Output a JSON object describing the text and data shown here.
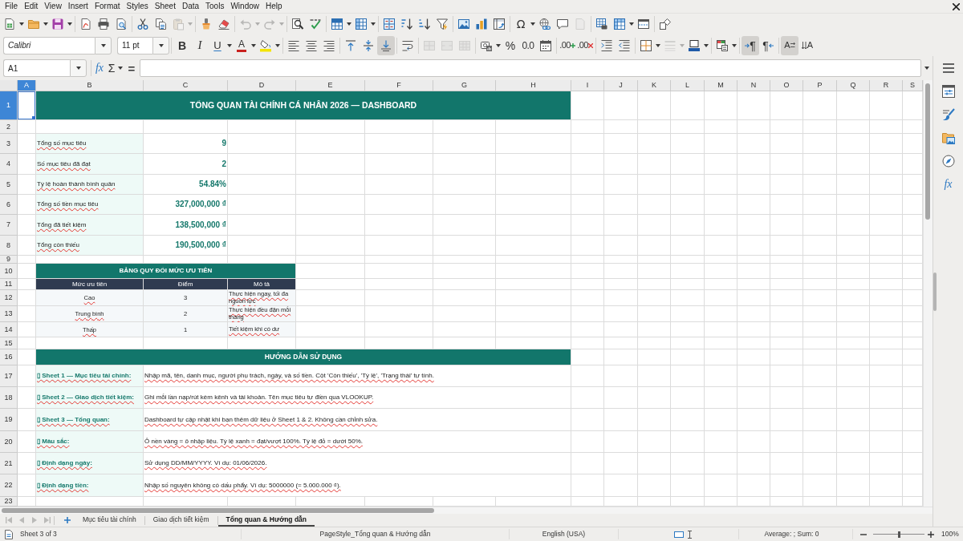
{
  "menu": [
    "File",
    "Edit",
    "View",
    "Insert",
    "Format",
    "Styles",
    "Sheet",
    "Data",
    "Tools",
    "Window",
    "Help"
  ],
  "toolbar_standard": [
    [
      {
        "kind": "new",
        "dropdown": true,
        "disabled": false
      },
      {
        "kind": "open",
        "dropdown": true,
        "disabled": false
      },
      {
        "kind": "save",
        "dropdown": true,
        "disabled": false
      }
    ],
    [
      {
        "kind": "pdf",
        "disabled": false
      },
      {
        "kind": "print",
        "disabled": false
      },
      {
        "kind": "preview",
        "disabled": false
      }
    ],
    [
      {
        "kind": "cut",
        "disabled": false
      },
      {
        "kind": "copy",
        "disabled": false
      },
      {
        "kind": "paste",
        "dropdown": true,
        "disabled": true
      }
    ],
    [
      {
        "kind": "clone",
        "disabled": false
      },
      {
        "kind": "clear",
        "disabled": false
      }
    ],
    [
      {
        "kind": "undo",
        "dropdown": true,
        "disabled": true
      },
      {
        "kind": "redo",
        "dropdown": true,
        "disabled": true
      }
    ],
    [
      {
        "kind": "find",
        "disabled": false
      },
      {
        "kind": "spelling",
        "disabled": false
      }
    ],
    [
      {
        "kind": "rows",
        "dropdown": true,
        "disabled": false
      },
      {
        "kind": "columns",
        "dropdown": true,
        "disabled": false
      }
    ],
    [
      {
        "kind": "sort",
        "disabled": false
      },
      {
        "kind": "sortup",
        "disabled": false
      },
      {
        "kind": "sortdown",
        "disabled": false
      },
      {
        "kind": "autofilter",
        "disabled": false
      }
    ],
    [
      {
        "kind": "image",
        "disabled": false
      },
      {
        "kind": "chart",
        "disabled": false
      },
      {
        "kind": "pivot",
        "disabled": false
      }
    ],
    [
      {
        "kind": "specialchar",
        "glyph": "Ω",
        "dropdown": true,
        "disabled": false
      },
      {
        "kind": "hyperlink",
        "disabled": false
      },
      {
        "kind": "comment",
        "disabled": false
      },
      {
        "kind": "headerfooter",
        "disabled": true
      }
    ],
    [
      {
        "kind": "printarea",
        "disabled": false
      },
      {
        "kind": "freeze",
        "dropdown": true,
        "disabled": false
      },
      {
        "kind": "split",
        "disabled": false
      }
    ],
    [
      {
        "kind": "shapes",
        "disabled": false
      }
    ]
  ],
  "toolbar_formatting": {
    "font_name": "Calibri",
    "font_size": "11 pt",
    "groups": [
      [
        {
          "kind": "bold",
          "glyph": "B",
          "disabled": false,
          "on": false
        },
        {
          "kind": "italic",
          "glyph": "I",
          "disabled": false,
          "on": false
        },
        {
          "kind": "underline",
          "glyph": "U",
          "dropdown": true,
          "disabled": false,
          "on": false
        },
        {
          "kind": "fontcolor",
          "glyph": "A",
          "dropdown": true,
          "disabled": false,
          "on": false
        },
        {
          "kind": "highlight",
          "dropdown": true,
          "disabled": false,
          "on": false
        }
      ],
      [
        {
          "kind": "alignleft",
          "disabled": false,
          "on": false
        },
        {
          "kind": "aligncenter",
          "disabled": false,
          "on": false
        },
        {
          "kind": "alignright",
          "disabled": false,
          "on": false
        }
      ],
      [
        {
          "kind": "aligntop",
          "disabled": false,
          "on": false
        },
        {
          "kind": "alignmiddle",
          "disabled": false,
          "on": false
        },
        {
          "kind": "alignbottom",
          "disabled": false,
          "on": true
        }
      ],
      [
        {
          "kind": "wrap",
          "disabled": false,
          "on": false
        }
      ],
      [
        {
          "kind": "mergecenter",
          "disabled": true,
          "on": false
        },
        {
          "kind": "merge",
          "disabled": true,
          "on": false
        },
        {
          "kind": "unmerge",
          "disabled": true,
          "on": false
        }
      ],
      [
        {
          "kind": "currency",
          "dropdown": true,
          "disabled": false,
          "on": false
        },
        {
          "kind": "percent",
          "glyph": "%",
          "disabled": false,
          "on": false
        },
        {
          "kind": "number",
          "glyph": "0.0",
          "disabled": false,
          "on": false
        },
        {
          "kind": "date",
          "disabled": false,
          "on": false
        }
      ],
      [
        {
          "kind": "adddecimal",
          "glyph": ".00",
          "disabled": false,
          "on": false
        },
        {
          "kind": "deldecimal",
          "glyph": ".00",
          "disabled": false,
          "on": false
        }
      ],
      [
        {
          "kind": "indent",
          "disabled": false,
          "on": false
        },
        {
          "kind": "outdent",
          "disabled": false,
          "on": false
        }
      ],
      [
        {
          "kind": "borders",
          "dropdown": true,
          "disabled": false,
          "on": false
        },
        {
          "kind": "borderstyle",
          "dropdown": true,
          "disabled": true,
          "on": false
        },
        {
          "kind": "bordercolor",
          "dropdown": true,
          "disabled": false,
          "on": false
        }
      ],
      [
        {
          "kind": "conditional",
          "dropdown": true,
          "disabled": false,
          "on": false
        }
      ],
      [
        {
          "kind": "ltr",
          "glyph": "¶",
          "disabled": false,
          "on": true
        },
        {
          "kind": "rtl",
          "glyph": "¶",
          "disabled": false,
          "on": false
        }
      ],
      [
        {
          "kind": "textdir",
          "glyph": "A",
          "disabled": false,
          "on": true
        },
        {
          "kind": "vertical",
          "glyph": "A",
          "disabled": false,
          "on": false
        }
      ]
    ]
  },
  "formula_bar": {
    "cell_reference": "A1",
    "function_glyph": "fx",
    "sum_glyph": "Σ",
    "formula_glyph": "="
  },
  "sheet": {
    "columns": [
      {
        "label": "A",
        "selected": true
      },
      {
        "label": "B",
        "selected": false
      },
      {
        "label": "C",
        "selected": false
      },
      {
        "label": "D",
        "selected": false
      },
      {
        "label": "E",
        "selected": false
      },
      {
        "label": "F",
        "selected": false
      },
      {
        "label": "G",
        "selected": false
      },
      {
        "label": "H",
        "selected": false
      },
      {
        "label": "I",
        "selected": false
      },
      {
        "label": "J",
        "selected": false
      },
      {
        "label": "K",
        "selected": false
      },
      {
        "label": "L",
        "selected": false
      },
      {
        "label": "M",
        "selected": false
      },
      {
        "label": "N",
        "selected": false
      },
      {
        "label": "O",
        "selected": false
      },
      {
        "label": "P",
        "selected": false
      },
      {
        "label": "Q",
        "selected": false
      },
      {
        "label": "R",
        "selected": false
      },
      {
        "label": "S",
        "selected": false
      }
    ],
    "row_headers": [
      {
        "number": "1",
        "selected": true
      },
      {
        "number": "2",
        "selected": false
      },
      {
        "number": "3",
        "selected": false
      },
      {
        "number": "4",
        "selected": false
      },
      {
        "number": "5",
        "selected": false
      },
      {
        "number": "6",
        "selected": false
      },
      {
        "number": "7",
        "selected": false
      },
      {
        "number": "8",
        "selected": false
      },
      {
        "number": "9",
        "selected": false
      },
      {
        "number": "10",
        "selected": false
      },
      {
        "number": "11",
        "selected": false
      },
      {
        "number": "12",
        "selected": false
      },
      {
        "number": "13",
        "selected": false
      },
      {
        "number": "14",
        "selected": false
      },
      {
        "number": "15",
        "selected": false
      },
      {
        "number": "16",
        "selected": false
      },
      {
        "number": "17",
        "selected": false
      },
      {
        "number": "18",
        "selected": false
      },
      {
        "number": "19",
        "selected": false
      },
      {
        "number": "20",
        "selected": false
      },
      {
        "number": "21",
        "selected": false
      },
      {
        "number": "22",
        "selected": false
      },
      {
        "number": "23",
        "selected": false
      }
    ],
    "title": "TỔNG QUAN TÀI CHÍNH CÁ NHÂN 2026 — DASHBOARD",
    "summary": [
      {
        "label": "Tổng số mục tiêu",
        "value": "9"
      },
      {
        "label": "Số mục tiêu đã đạt",
        "value": "2"
      },
      {
        "label": "Tỷ lệ hoàn thành bình quân",
        "value": "54.84%"
      },
      {
        "label": "Tổng số tiền mục tiêu",
        "value": "327,000,000 ₫"
      },
      {
        "label": "Tổng đã tiết kiệm",
        "value": "138,500,000 ₫"
      },
      {
        "label": "Tổng còn thiếu",
        "value": "190,500,000 ₫"
      }
    ],
    "priority_table": {
      "title": "BẢNG QUY ĐỔI MỨC ƯU TIÊN",
      "columns": [
        "Mức ưu tiên",
        "Điểm",
        "Mô tả"
      ],
      "rows": [
        [
          "Cao",
          "3",
          "Thực hiện ngay, tối đa nguồn lực"
        ],
        [
          "Trung bình",
          "2",
          "Thực hiện đều đặn mỗi tháng"
        ],
        [
          "Thấp",
          "1",
          "Tiết kiệm khi có dư"
        ]
      ]
    },
    "guide": {
      "title": "HƯỚNG DẪN SỬ DỤNG",
      "items": [
        {
          "label": "▯ Sheet 1 — Mục tiêu tài chính:",
          "text": "Nhập mã, tên, danh mục, người phụ trách, ngày, và số tiền. Cột 'Còn thiếu', 'Tỷ lệ', 'Trạng thái' tự tính."
        },
        {
          "label": "▯ Sheet 2 — Giao dịch tiết kiệm:",
          "text": "Ghi mỗi lần nạp/rút kèm kênh và tài khoản. Tên mục tiêu tự điền qua VLOOKUP."
        },
        {
          "label": "▯ Sheet 3 — Tổng quan:",
          "text": "Dashboard tự cập nhật khi bạn thêm dữ liệu ở Sheet 1 & 2. Không cần chỉnh sửa."
        },
        {
          "label": "▯ Màu sắc:",
          "text": "Ô nền vàng = ô nhập liệu. Tỷ lệ xanh = đạt/vượt 100%. Tỷ lệ đỏ = dưới 50%."
        },
        {
          "label": "▯ Định dạng ngày:",
          "text": "Sử dụng DD/MM/YYYY. Ví dụ: 01/06/2026."
        },
        {
          "label": "▯ Định dạng tiền:",
          "text": "Nhập số nguyên không có dấu phẩy. Ví dụ: 5000000 (= 5.000.000 ₫)."
        }
      ]
    }
  },
  "sheet_tabs": {
    "navigation": [
      {
        "kind": "first",
        "disabled": true
      },
      {
        "kind": "previous",
        "disabled": true
      },
      {
        "kind": "next",
        "disabled": true
      },
      {
        "kind": "last",
        "disabled": true
      }
    ],
    "tabs": [
      {
        "label": "Mục tiêu tài chính",
        "selected": false
      },
      {
        "label": "Giao dịch tiết kiệm",
        "selected": false
      },
      {
        "label": "Tổng quan & Hướng dẫn",
        "selected": true
      }
    ]
  },
  "sidebar": [
    {
      "kind": "menu"
    },
    {
      "kind": "properties"
    },
    {
      "kind": "styles"
    },
    {
      "kind": "gallery"
    },
    {
      "kind": "navigator"
    },
    {
      "kind": "functions",
      "glyph": "fx"
    }
  ],
  "status_bar": {
    "sheet": "Sheet 3 of 3",
    "page_style": "PageStyle_Tổng quan & Hướng dẫn",
    "language": "English (USA)",
    "selection": "Average: ; Sum: 0",
    "zoom": {
      "level": 0.5,
      "reading": "100%"
    }
  }
}
